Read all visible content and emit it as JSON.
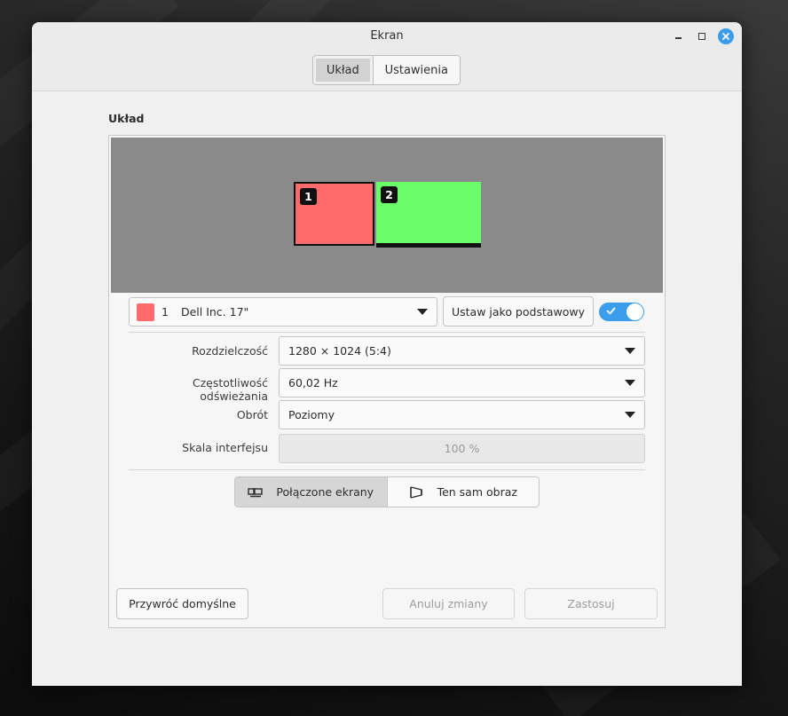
{
  "window": {
    "title": "Ekran",
    "tabs": [
      {
        "label": "Układ",
        "active": true
      },
      {
        "label": "Ustawienia",
        "active": false
      }
    ]
  },
  "layout": {
    "heading": "Układ",
    "monitors": [
      {
        "number": "1",
        "color": "#ff6a6a",
        "selected": true
      },
      {
        "number": "2",
        "color": "#6aff6a",
        "selected": false
      }
    ],
    "monitor_select": {
      "swatch_color": "#ff6a6a",
      "number": "1",
      "name": "Dell Inc. 17\""
    },
    "primary_button": "Ustaw jako podstawowy",
    "enabled": true,
    "rows": {
      "resolution": {
        "label": "Rozdzielczość",
        "value": "1280 × 1024 (5:4)"
      },
      "refresh": {
        "label": "Częstotliwość odświeżania",
        "value": "60,02 Hz"
      },
      "rotation": {
        "label": "Obrót",
        "value": "Poziomy"
      },
      "scale": {
        "label": "Skala interfejsu",
        "value": "100 %"
      }
    },
    "modes": [
      {
        "label": "Połączone ekrany",
        "active": true
      },
      {
        "label": "Ten sam obraz",
        "active": false
      }
    ],
    "footer": {
      "reset": "Przywróć domyślne",
      "cancel": "Anuluj zmiany",
      "apply": "Zastosuj"
    }
  },
  "colors": {
    "accent": "#3c9eea",
    "monitor1": "#ff6a6a",
    "monitor2": "#6aff6a"
  },
  "icons": [
    "minimize-icon",
    "maximize-icon",
    "close-icon",
    "dropdown-arrow-icon",
    "check-icon",
    "joined-displays-icon",
    "mirror-displays-icon"
  ]
}
